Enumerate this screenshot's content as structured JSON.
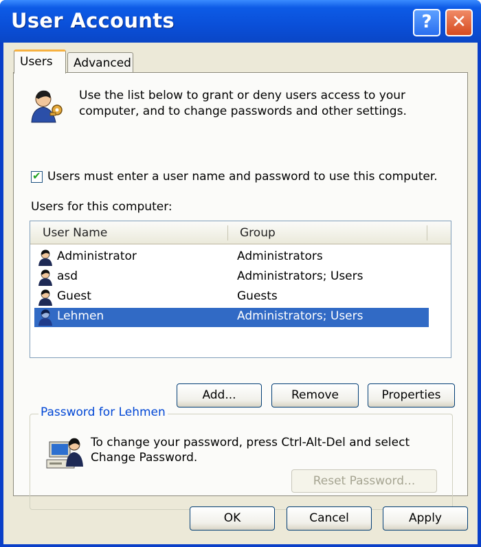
{
  "window": {
    "title": "User Accounts",
    "help_label": "?",
    "close_label": "✕"
  },
  "tabs": [
    {
      "label": "Users",
      "active": true
    },
    {
      "label": "Advanced",
      "active": false
    }
  ],
  "intro": "Use the list below to grant or deny users access to your computer, and to change passwords and other settings.",
  "require_login": {
    "checked": true,
    "label": "Users must enter a user name and password to use this computer."
  },
  "users_list": {
    "label": "Users for this computer:",
    "columns": [
      "User Name",
      "Group"
    ],
    "rows": [
      {
        "name": "Administrator",
        "group": "Administrators"
      },
      {
        "name": "asd",
        "group": "Administrators; Users"
      },
      {
        "name": "Guest",
        "group": "Guests"
      },
      {
        "name": "Lehmen",
        "group": "Administrators; Users",
        "selected": true
      }
    ]
  },
  "list_buttons": {
    "add": "Add...",
    "remove": "Remove",
    "properties": "Properties"
  },
  "password_box": {
    "title": "Password for Lehmen",
    "text": "To change your password, press Ctrl-Alt-Del and select Change Password.",
    "reset_button": "Reset Password..."
  },
  "footer": {
    "ok": "OK",
    "cancel": "Cancel",
    "apply": "Apply"
  },
  "colors": {
    "title_bar": "#0a4fd8",
    "selection": "#316ac5",
    "group_title": "#0046d5"
  },
  "icons": [
    "help-icon",
    "close-icon",
    "users-key-icon",
    "user-icon",
    "computer-user-icon"
  ]
}
